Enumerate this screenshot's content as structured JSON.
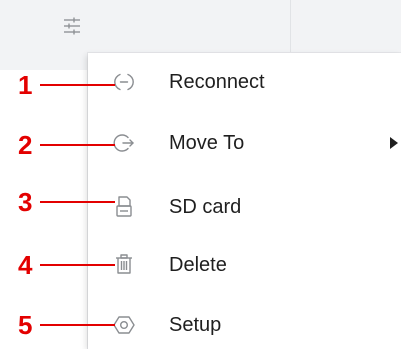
{
  "menu": {
    "items": [
      {
        "label": "Reconnect",
        "icon": "reconnect-icon",
        "has_submenu": false
      },
      {
        "label": "Move To",
        "icon": "move-to-icon",
        "has_submenu": true
      },
      {
        "label": "SD card",
        "icon": "sd-card-icon",
        "has_submenu": false
      },
      {
        "label": "Delete",
        "icon": "trash-icon",
        "has_submenu": false
      },
      {
        "label": "Setup",
        "icon": "settings-icon",
        "has_submenu": false
      }
    ]
  },
  "callouts": [
    "1",
    "2",
    "3",
    "4",
    "5"
  ],
  "colors": {
    "callout": "#e30000",
    "icon": "#8a8d91",
    "text": "#1f1f1f"
  }
}
